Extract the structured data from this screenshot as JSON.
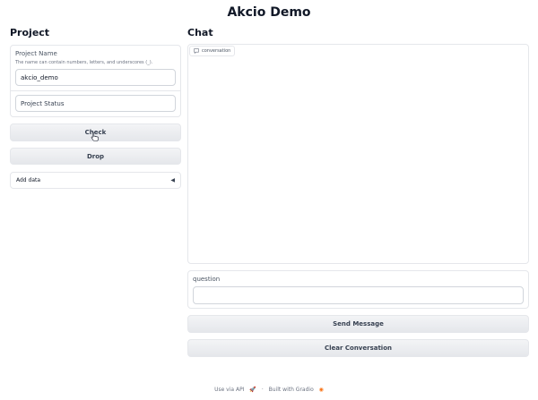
{
  "app": {
    "title": "Akcio Demo"
  },
  "left": {
    "heading": "Project",
    "project_name": {
      "label": "Project Name",
      "info": "The name can contain numbers, letters, and underscores (_).",
      "value": "akcio_demo"
    },
    "project_status": {
      "placeholder": "Project Status"
    },
    "check_label": "Check",
    "drop_label": "Drop",
    "add_data_label": "Add data",
    "add_data_icon": "triangle-left-icon"
  },
  "right": {
    "heading": "Chat",
    "chat_tag": "conversation",
    "chat_tag_icon": "chat-bubble-icon",
    "question_label": "question",
    "question_value": "",
    "send_label": "Send Message",
    "clear_label": "Clear Conversation"
  },
  "footer": {
    "api": "Use via API",
    "separator": "·",
    "built": "Built with Gradio"
  }
}
